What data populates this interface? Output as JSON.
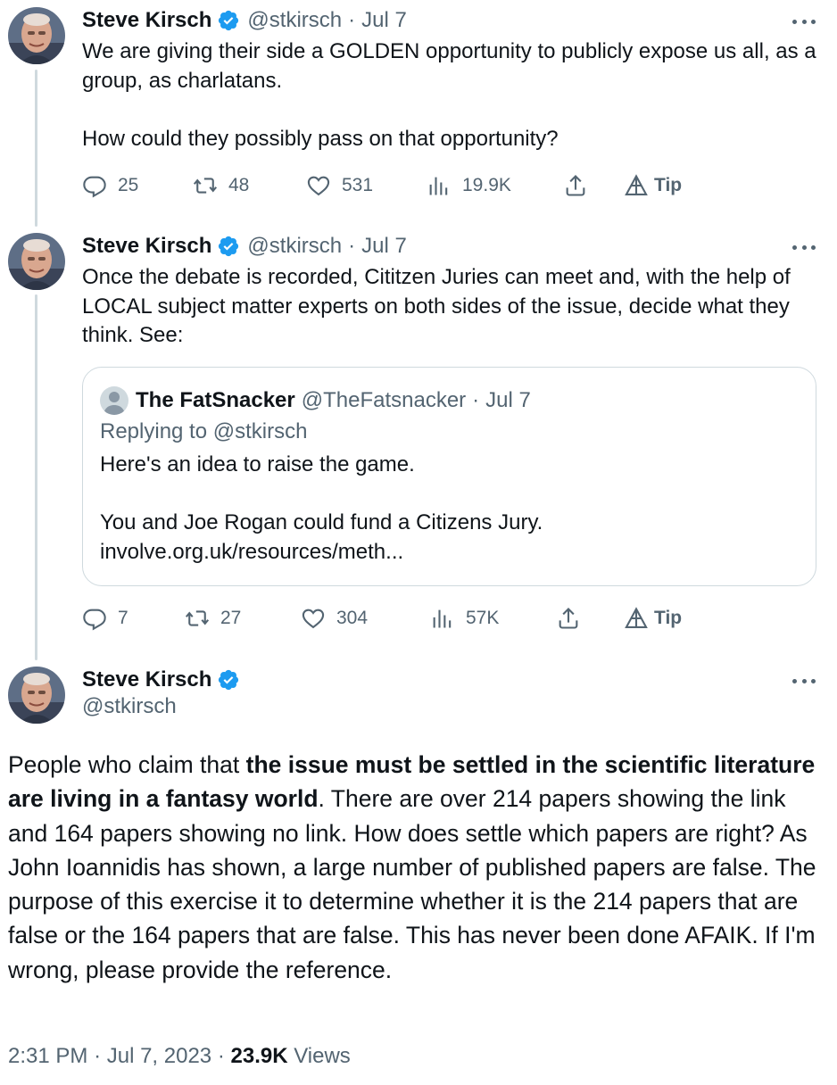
{
  "tweets": [
    {
      "name": "Steve Kirsch",
      "handle": "@stkirsch",
      "sep": "·",
      "date": "Jul 7",
      "text": "We are giving their side a GOLDEN opportunity to publicly expose us all, as a group, as charlatans.\n\nHow could they possibly pass on that opportunity?",
      "replies": "25",
      "retweets": "48",
      "likes": "531",
      "views": "19.9K",
      "tip": "Tip"
    },
    {
      "name": "Steve Kirsch",
      "handle": "@stkirsch",
      "sep": "·",
      "date": "Jul 7",
      "text": "Once the debate is recorded, Cititzen Juries can meet and, with the help of LOCAL subject matter experts on both sides of the issue, decide what they think. See:",
      "replies": "7",
      "retweets": "27",
      "likes": "304",
      "views": "57K",
      "tip": "Tip"
    }
  ],
  "quote": {
    "name": "The FatSnacker",
    "handle": "@TheFatsnacker",
    "sep": "·",
    "date": "Jul 7",
    "replying": "Replying to @stkirsch",
    "text": "Here's an idea to raise the game.\n\nYou and Joe Rogan could fund a Citizens Jury.\ninvolve.org.uk/resources/meth..."
  },
  "main": {
    "name": "Steve Kirsch",
    "handle": "@stkirsch",
    "text_before": "People who claim that ",
    "text_bold": "the issue must be settled in the scientific literature are living in a fantasy world",
    "text_after": ". There are over 214 papers showing the link and 164 papers showing no link. How does settle which papers are right? As John Ioannidis has shown, a large number of published papers are false. The purpose of this exercise it to determine whether it is the 214 papers that are false or the 164 papers that are false. This has never been done AFAIK. If I'm wrong, please provide the reference.",
    "time": "2:31 PM",
    "sep": "·",
    "date": "Jul 7, 2023",
    "views_count": "23.9K",
    "views_label": "Views"
  },
  "colors": {
    "text": "#0f1419",
    "muted": "#536471",
    "verified": "#1d9bf0",
    "border": "#cfd9de"
  },
  "icons": [
    "reply-icon",
    "retweet-icon",
    "like-icon",
    "views-icon",
    "share-icon",
    "tip-icon",
    "verified-badge-icon",
    "more-icon"
  ]
}
